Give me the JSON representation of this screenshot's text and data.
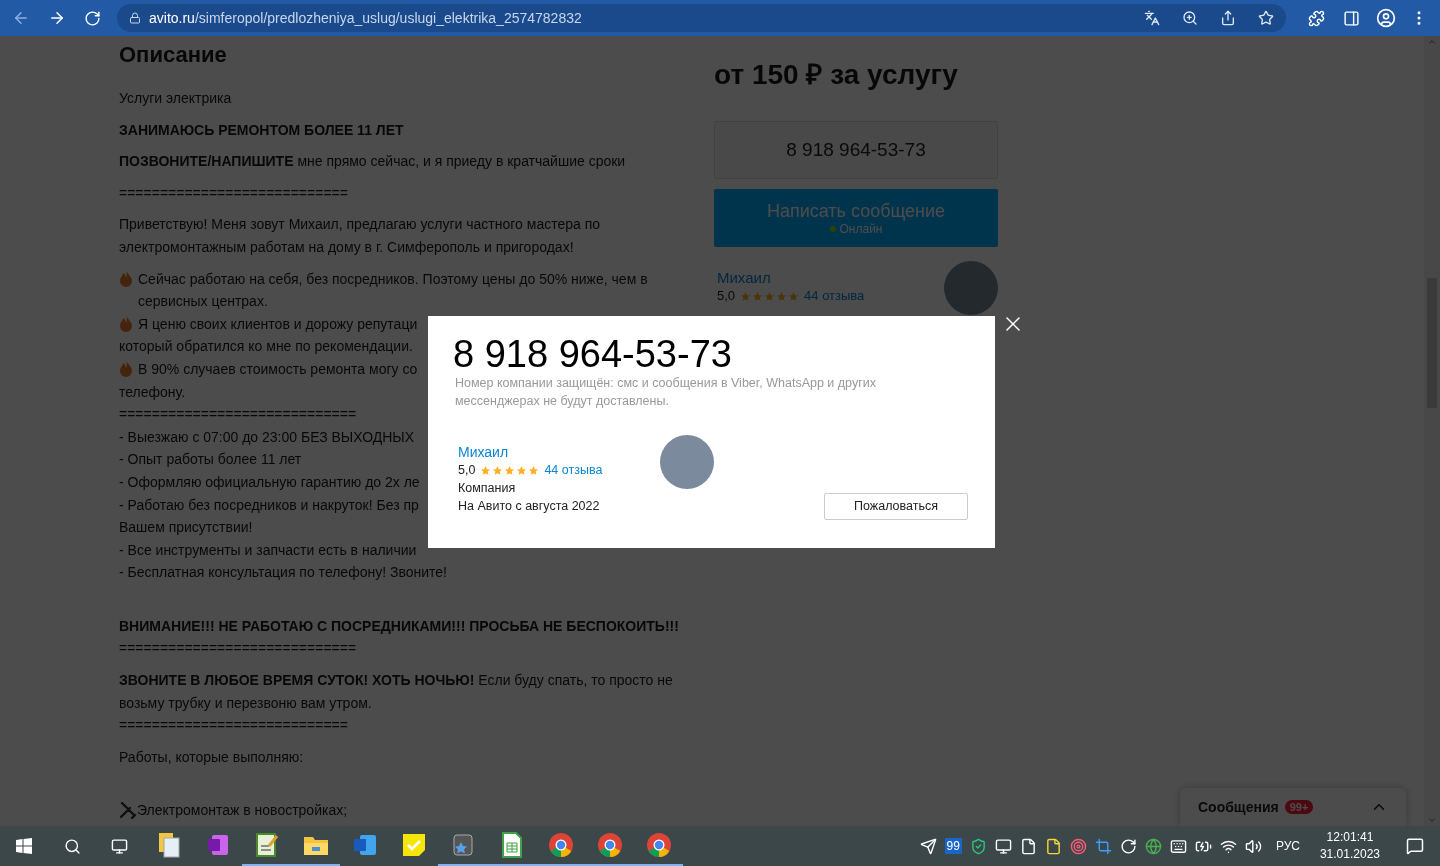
{
  "browser": {
    "url_host": "avito.ru",
    "url_path": "/simferopol/predlozheniya_uslug/uslugi_elektrika_2574782832"
  },
  "description": {
    "title": "Описание",
    "paragraphs": [
      {
        "blank_line_before": false,
        "lines": [
          {
            "kind": "text",
            "text": "Услуги электрика"
          }
        ]
      },
      {
        "blank_line_before": false,
        "lines": [
          {
            "kind": "bold",
            "text": "ЗАНИМАЮСЬ РЕМОНТОМ БОЛЕЕ 11 ЛЕТ"
          }
        ]
      },
      {
        "blank_line_before": false,
        "lines": [
          {
            "kind": "text",
            "text": "**ПОЗВОНИТЕ/НАПИШИТЕ** мне прямо сейчас, и я приеду в кратчайшие сроки"
          }
        ]
      },
      {
        "blank_line_before": false,
        "lines": [
          {
            "kind": "text",
            "text": "============================"
          }
        ]
      },
      {
        "blank_line_before": false,
        "lines": [
          {
            "kind": "text",
            "text": "Приветствую! Меня зовут Михаил, предлагаю услуги частного мастера по электромонтажным работам на дому в г. Симферополь и пригородах!"
          }
        ]
      },
      {
        "blank_line_before": false,
        "lines": [
          {
            "kind": "fire",
            "text": "Сейчас работаю на себя, без посредников. Поэтому цены до 50% ниже, чем в сервисных центрах."
          },
          {
            "kind": "fire",
            "text": "Я ценю своих клиентов и дорожу репутаци"
          },
          {
            "kind": "text",
            "text": "который обратился ко мне по рекомендации."
          },
          {
            "kind": "fire",
            "text": "В 90% случаев стоимость ремонта могу со"
          },
          {
            "kind": "text",
            "text": "телефону."
          },
          {
            "kind": "text",
            "text": "============================="
          },
          {
            "kind": "text",
            "text": "- Выезжаю с 07:00 до 23:00 БЕЗ ВЫХОДНЫХ"
          },
          {
            "kind": "text",
            "text": "- Опыт работы более 11 лет"
          },
          {
            "kind": "text",
            "text": "- Оформляю официальную гарантию до 2х ле"
          },
          {
            "kind": "text",
            "text": "- Работаю без посредников и накруток! Без пр"
          },
          {
            "kind": "text",
            "text": "Вашем присутствии!"
          },
          {
            "kind": "text",
            "text": "- Все инструменты и запчасти есть в наличии"
          },
          {
            "kind": "text",
            "text": "- Бесплатная консультация по телефону! Звоните!"
          }
        ]
      },
      {
        "blank_line_before": true,
        "lines": [
          {
            "kind": "bold",
            "text": "ВНИМАНИЕ!!! НЕ РАБОТАЮ С ПОСРЕДНИКАМИ!!! ПРОСЬБА НЕ БЕСПОКОИТЬ!!!"
          },
          {
            "kind": "text",
            "text": "============================="
          }
        ]
      },
      {
        "blank_line_before": false,
        "lines": [
          {
            "kind": "text",
            "text": "**ЗВОНИТЕ В ЛЮБОЕ ВРЕМЯ СУТОК! ХОТЬ НОЧЬЮ!** Если буду спать, то просто не возьму трубку и перезвоню вам утром."
          },
          {
            "kind": "text",
            "text": "============================"
          }
        ]
      },
      {
        "blank_line_before": false,
        "lines": [
          {
            "kind": "text",
            "text": "Работы, которые выполняю:"
          }
        ]
      },
      {
        "blank_line_before": true,
        "lines": [
          {
            "kind": "tools",
            "text": "Электромонтаж в новостройках;"
          }
        ]
      }
    ]
  },
  "sidebar": {
    "price": "от 150 ₽ за услугу",
    "phone_button": "8 918 964-53-73",
    "message_button": "Написать сообщение",
    "online_status": "Онлайн",
    "seller": {
      "name": "Михаил",
      "rating": "5,0",
      "stars": 5,
      "reviews": "44 отзыва"
    }
  },
  "messages_widget": {
    "label": "Сообщения",
    "badge": "99+"
  },
  "phone_modal": {
    "phone": "8 918 964-53-73",
    "note": "Номер компании защищён: смс и сообщения в Viber, WhatsApp и других мессенджерах не будут доставлены.",
    "seller": {
      "name": "Михаил",
      "rating": "5,0",
      "stars": 5,
      "reviews": "44 отзыва",
      "type": "Компания",
      "since": "На Авито с августа 2022"
    },
    "report_button": "Пожаловаться"
  },
  "taskbar": {
    "apps": [
      {
        "kind": "files",
        "running": false
      },
      {
        "kind": "onenote",
        "running": false
      },
      {
        "kind": "editor",
        "running": true
      },
      {
        "kind": "folder",
        "running": true
      },
      {
        "kind": "word",
        "running": false
      },
      {
        "kind": "sticky",
        "running": false
      },
      {
        "kind": "stars",
        "running": true
      },
      {
        "kind": "sheet",
        "running": true
      },
      {
        "kind": "chrome",
        "running": true
      },
      {
        "kind": "chrome",
        "running": true
      },
      {
        "kind": "chrome",
        "running": true
      }
    ],
    "tray_badge": "99",
    "language": "РУС",
    "time": "12:01:41",
    "date": "31.01.2023"
  }
}
